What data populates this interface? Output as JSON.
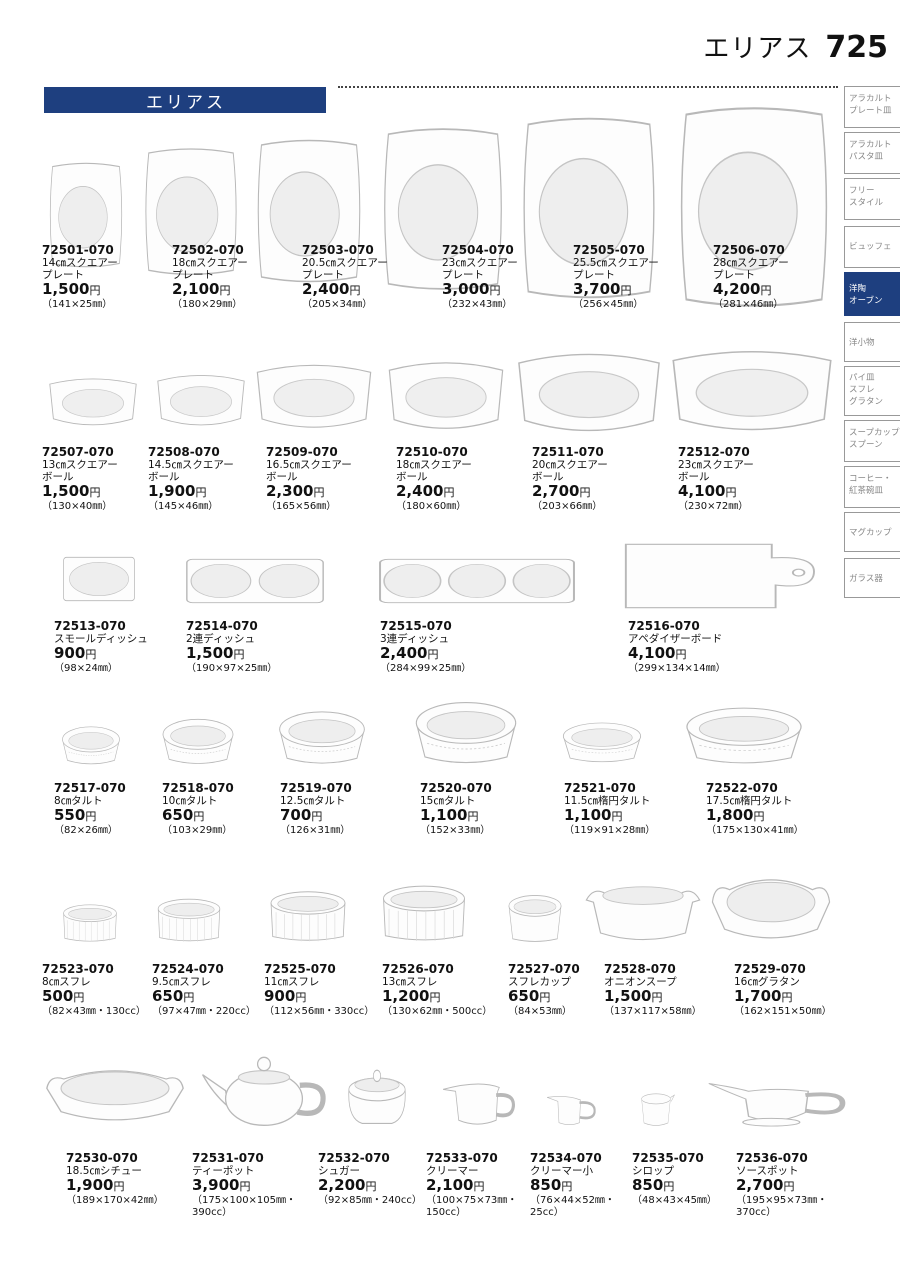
{
  "header": {
    "series_title": "エリアス",
    "page_number": "725",
    "banner_title": "エリアス"
  },
  "side_tabs": [
    {
      "label": "アラカルト\nプレート皿",
      "active": false
    },
    {
      "label": "アラカルト\nパスタ皿",
      "active": false
    },
    {
      "label": "フリー\nスタイル",
      "active": false
    },
    {
      "label": "ビュッフェ",
      "active": false
    },
    {
      "label": "洋陶\nオーブン",
      "active": true
    },
    {
      "label": "洋小物",
      "active": false
    },
    {
      "label": "パイ皿\nスフレ\nグラタン",
      "active": false
    },
    {
      "label": "スープカップ\nスプーン",
      "active": false
    },
    {
      "label": "コーヒー・\n紅茶碗皿",
      "active": false
    },
    {
      "label": "マグカップ",
      "active": false
    },
    {
      "label": "ガラス器",
      "active": false
    }
  ],
  "products": [
    {
      "code": "72501-070",
      "name": "14㎝スクエアー\nプレート",
      "price": "1,500",
      "yen": "円",
      "size": "（141×25㎜）",
      "shape": "plate"
    },
    {
      "code": "72502-070",
      "name": "18㎝スクエアー\nプレート",
      "price": "2,100",
      "yen": "円",
      "size": "（180×29㎜）",
      "shape": "plate"
    },
    {
      "code": "72503-070",
      "name": "20.5㎝スクエアー\nプレート",
      "price": "2,400",
      "yen": "円",
      "size": "（205×34㎜）",
      "shape": "plate"
    },
    {
      "code": "72504-070",
      "name": "23㎝スクエアー\nプレート",
      "price": "3,000",
      "yen": "円",
      "size": "（232×43㎜）",
      "shape": "plate"
    },
    {
      "code": "72505-070",
      "name": "25.5㎝スクエアー\nプレート",
      "price": "3,700",
      "yen": "円",
      "size": "（256×45㎜）",
      "shape": "plate"
    },
    {
      "code": "72506-070",
      "name": "28㎝スクエアー\nプレート",
      "price": "4,200",
      "yen": "円",
      "size": "（281×46㎜）",
      "shape": "plate"
    },
    {
      "code": "72507-070",
      "name": "13㎝スクエアー\nボール",
      "price": "1,500",
      "yen": "円",
      "size": "（130×40㎜）",
      "shape": "bowl"
    },
    {
      "code": "72508-070",
      "name": "14.5㎝スクエアー\nボール",
      "price": "1,900",
      "yen": "円",
      "size": "（145×46㎜）",
      "shape": "bowl"
    },
    {
      "code": "72509-070",
      "name": "16.5㎝スクエアー\nボール",
      "price": "2,300",
      "yen": "円",
      "size": "（165×56㎜）",
      "shape": "bowl"
    },
    {
      "code": "72510-070",
      "name": "18㎝スクエアー\nボール",
      "price": "2,400",
      "yen": "円",
      "size": "（180×60㎜）",
      "shape": "bowl"
    },
    {
      "code": "72511-070",
      "name": "20㎝スクエアー\nボール",
      "price": "2,700",
      "yen": "円",
      "size": "（203×66㎜）",
      "shape": "bowl"
    },
    {
      "code": "72512-070",
      "name": "23㎝スクエアー\nボール",
      "price": "4,100",
      "yen": "円",
      "size": "（230×72㎜）",
      "shape": "bowl"
    },
    {
      "code": "72513-070",
      "name": "スモールディッシュ",
      "price": "900",
      "yen": "円",
      "size": "（98×24㎜）",
      "shape": "dish1"
    },
    {
      "code": "72514-070",
      "name": "2連ディッシュ",
      "price": "1,500",
      "yen": "円",
      "size": "（190×97×25㎜）",
      "shape": "dish2"
    },
    {
      "code": "72515-070",
      "name": "3連ディッシュ",
      "price": "2,400",
      "yen": "円",
      "size": "（284×99×25㎜）",
      "shape": "dish3"
    },
    {
      "code": "72516-070",
      "name": "アペダイザーボード",
      "price": "4,100",
      "yen": "円",
      "size": "（299×134×14㎜）",
      "shape": "board"
    },
    {
      "code": "72517-070",
      "name": "8㎝タルト",
      "price": "550",
      "yen": "円",
      "size": "（82×26㎜）",
      "shape": "tart"
    },
    {
      "code": "72518-070",
      "name": "10㎝タルト",
      "price": "650",
      "yen": "円",
      "size": "（103×29㎜）",
      "shape": "tart"
    },
    {
      "code": "72519-070",
      "name": "12.5㎝タルト",
      "price": "700",
      "yen": "円",
      "size": "（126×31㎜）",
      "shape": "tart"
    },
    {
      "code": "72520-070",
      "name": "15㎝タルト",
      "price": "1,100",
      "yen": "円",
      "size": "（152×33㎜）",
      "shape": "tart"
    },
    {
      "code": "72521-070",
      "name": "11.5㎝楕円タルト",
      "price": "1,100",
      "yen": "円",
      "size": "（119×91×28㎜）",
      "shape": "tart"
    },
    {
      "code": "72522-070",
      "name": "17.5㎝楕円タルト",
      "price": "1,800",
      "yen": "円",
      "size": "（175×130×41㎜）",
      "shape": "tart"
    },
    {
      "code": "72523-070",
      "name": "8㎝スフレ",
      "price": "500",
      "yen": "円",
      "size": "（82×43㎜・130cc）",
      "shape": "souffle"
    },
    {
      "code": "72524-070",
      "name": "9.5㎝スフレ",
      "price": "650",
      "yen": "円",
      "size": "（97×47㎜・220cc）",
      "shape": "souffle"
    },
    {
      "code": "72525-070",
      "name": "11㎝スフレ",
      "price": "900",
      "yen": "円",
      "size": "（112×56㎜・330cc）",
      "shape": "souffle"
    },
    {
      "code": "72526-070",
      "name": "13㎝スフレ",
      "price": "1,200",
      "yen": "円",
      "size": "（130×62㎜・500cc）",
      "shape": "souffle"
    },
    {
      "code": "72527-070",
      "name": "スフレカップ",
      "price": "650",
      "yen": "円",
      "size": "（84×53㎜）",
      "shape": "cup"
    },
    {
      "code": "72528-070",
      "name": "オニオンスープ",
      "price": "1,500",
      "yen": "円",
      "size": "（137×117×58㎜）",
      "shape": "onion"
    },
    {
      "code": "72529-070",
      "name": "16㎝グラタン",
      "price": "1,700",
      "yen": "円",
      "size": "（162×151×50㎜）",
      "shape": "gratin"
    },
    {
      "code": "72530-070",
      "name": "18.5㎝シチュー",
      "price": "1,900",
      "yen": "円",
      "size": "（189×170×42㎜）",
      "shape": "stew"
    },
    {
      "code": "72531-070",
      "name": "ティーポット",
      "price": "3,900",
      "yen": "円",
      "size": "（175×100×105㎜・\n390cc）",
      "shape": "teapot"
    },
    {
      "code": "72532-070",
      "name": "シュガー",
      "price": "2,200",
      "yen": "円",
      "size": "（92×85㎜・240cc）",
      "shape": "sugar"
    },
    {
      "code": "72533-070",
      "name": "クリーマー",
      "price": "2,100",
      "yen": "円",
      "size": "（100×75×73㎜・\n150cc）",
      "shape": "creamer"
    },
    {
      "code": "72534-070",
      "name": "クリーマー小",
      "price": "850",
      "yen": "円",
      "size": "（76×44×52㎜・\n25cc）",
      "shape": "creamer_small"
    },
    {
      "code": "72535-070",
      "name": "シロップ",
      "price": "850",
      "yen": "円",
      "size": "（48×43×45㎜）",
      "shape": "syrup"
    },
    {
      "code": "72536-070",
      "name": "ソースポット",
      "price": "2,700",
      "yen": "円",
      "size": "（195×95×73㎜・\n370cc）",
      "shape": "saucepot"
    }
  ]
}
